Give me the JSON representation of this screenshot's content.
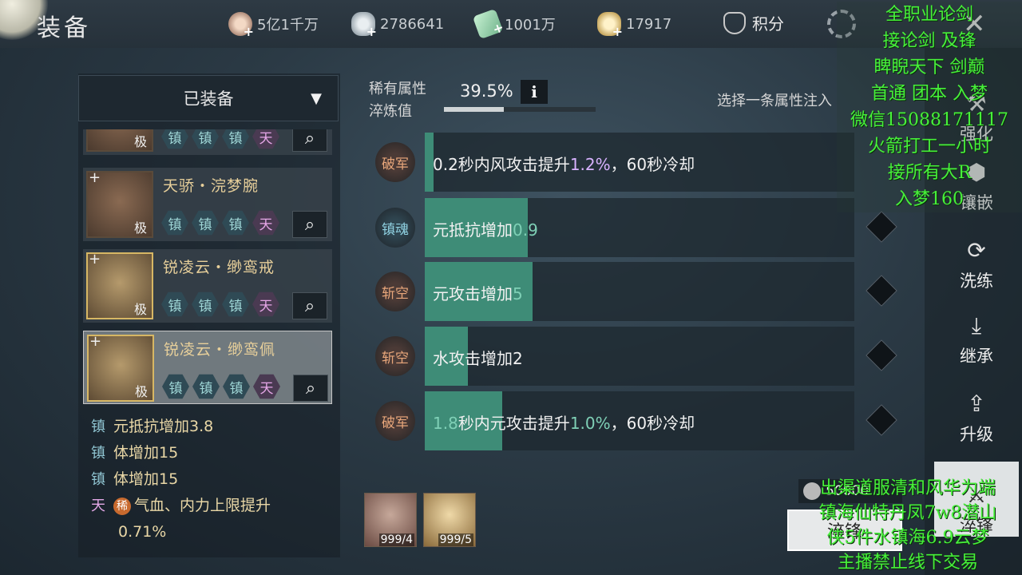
{
  "header": {
    "title": "装备",
    "currencies": [
      {
        "icon": "coin-icon",
        "value": "5亿1千万"
      },
      {
        "icon": "silver-ingot-icon",
        "value": "2786641"
      },
      {
        "icon": "jade-icon",
        "value": "1001万"
      },
      {
        "icon": "gold-ingot-icon",
        "value": "17917"
      }
    ],
    "score_label": "积分"
  },
  "dropdown": {
    "label": "已装备"
  },
  "items": [
    {
      "name": "",
      "grade": "极",
      "gems": [
        "镇",
        "镇",
        "镇",
        "天"
      ],
      "selected": false
    },
    {
      "name": "天骄・浣梦腕",
      "grade": "极",
      "gems": [
        "镇",
        "镇",
        "镇",
        "天"
      ],
      "selected": false
    },
    {
      "name": "锐凌云・缈鸾戒",
      "grade": "极",
      "gems": [
        "镇",
        "镇",
        "镇",
        "天"
      ],
      "selected": false
    },
    {
      "name": "锐凌云・缈鸾佩",
      "grade": "极",
      "gems": [
        "镇",
        "镇",
        "镇",
        "天"
      ],
      "selected": true
    }
  ],
  "item_attributes": [
    {
      "tag": "镇",
      "text": "元抵抗增加3.8"
    },
    {
      "tag": "镇",
      "text": "体增加15"
    },
    {
      "tag": "镇",
      "text": "体增加15"
    },
    {
      "tag": "天",
      "rare": "稀",
      "text": "气血、内力上限提升",
      "text2": "0.71%"
    }
  ],
  "refine": {
    "rare_label": "稀有属性",
    "value_label": "淬炼值",
    "percent": "39.5%",
    "percent_value": 0.395,
    "info": "i",
    "hint": "选择一条属性注入"
  },
  "rows": [
    {
      "badge": "破军",
      "pre": "0.2秒内风攻击提升",
      "hl": "1.2%",
      "hl_color": "purple",
      "post": "，60秒冷却",
      "fill": 0.02
    },
    {
      "badge": "镇魂",
      "pre": "元抵抗增加",
      "hl": "0.9",
      "hl_color": "green",
      "post": "",
      "fill": 0.24
    },
    {
      "badge": "斩空",
      "pre": "元攻击增加",
      "hl": "5",
      "hl_color": "green",
      "post": "",
      "fill": 0.25
    },
    {
      "badge": "斩空",
      "pre": "水攻击增加2",
      "hl": "",
      "hl_color": "green",
      "post": "",
      "fill": 0.1
    },
    {
      "badge": "破军",
      "pre": "",
      "hl": "1.8",
      "hl_color": "green",
      "mid": "秒内元攻击提升",
      "hl2": "1.0%",
      "post": "，60秒冷却",
      "fill": 0.18
    }
  ],
  "sidebar": [
    {
      "icon": "forge-icon",
      "label": "强化"
    },
    {
      "icon": "inlay-icon",
      "label": "镶嵌"
    },
    {
      "icon": "reroll-icon",
      "label": "洗练"
    },
    {
      "icon": "inherit-icon",
      "label": "继承"
    },
    {
      "icon": "upgrade-icon",
      "label": "升级"
    },
    {
      "icon": "refine-icon",
      "label": "淬锋"
    }
  ],
  "materials": [
    {
      "count": "999/4"
    },
    {
      "count": "999/5"
    }
  ],
  "cost": "50000",
  "action_button": "淬锋",
  "overlay_top": [
    "全职业论剑",
    "接论剑 及锋",
    "睥睨天下  剑巅",
    "首通 团本 入梦",
    "微信15088171117",
    "火箭打工一小时",
    "接所有大R",
    "入梦160"
  ],
  "overlay_bottom": [
    "出渠道服清和风华为端",
    "镇海仙特丹凤7w8潜山",
    "侠5件水镇海6.9云梦",
    "主播禁止线下交易"
  ],
  "colors": {
    "fill_green": "#3e8c77",
    "overlay_green": "#47f03a",
    "item_name": "#e7cf9a"
  }
}
